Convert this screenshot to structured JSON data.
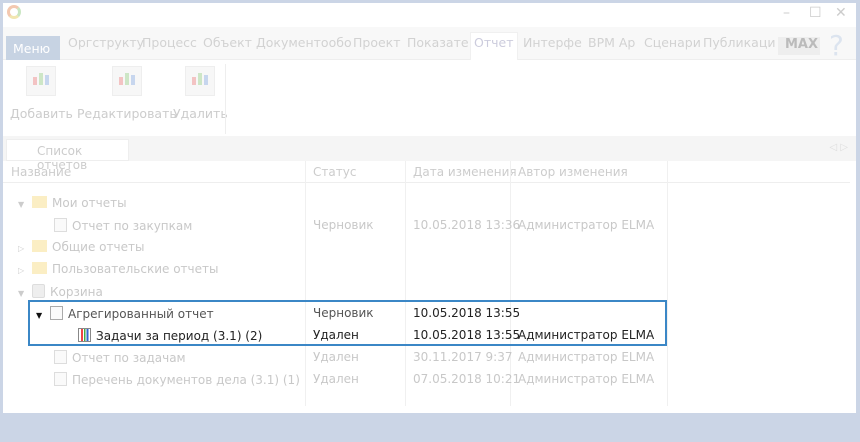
{
  "window": {
    "controls": [
      "–",
      "☐",
      "✕"
    ]
  },
  "menu": {
    "label": "Меню",
    "tabs": [
      "Оргструкту",
      "Процесс",
      "Объект",
      "Документообо",
      "Проект",
      "Показате",
      "Отчет",
      "Интерфе",
      "BPM Ap",
      "Сценари",
      "Публикаци"
    ],
    "max": "MAX",
    "help": "?"
  },
  "ribbon": {
    "add": "Добавить",
    "edit": "Редактировать",
    "delete": "Удалить"
  },
  "doc_tab": {
    "label": "Список отчетов"
  },
  "table": {
    "headers": [
      "Название",
      "Статус",
      "Дата изменения",
      "Автор изменения"
    ],
    "rows": [
      {
        "name": "Мои отчеты",
        "status": "",
        "date": "",
        "author": ""
      },
      {
        "name": "Отчет по закупкам",
        "status": "Черновик",
        "date": "10.05.2018 13:36",
        "author": "Администратор ELMA"
      },
      {
        "name": "Общие отчеты",
        "status": "",
        "date": "",
        "author": ""
      },
      {
        "name": "Пользовательские отчеты",
        "status": "",
        "date": "",
        "author": ""
      },
      {
        "name": "Корзина",
        "status": "",
        "date": "",
        "author": ""
      },
      {
        "name": "Агрегированный отчет",
        "status": "Черновик",
        "date": "10.05.2018 13:55",
        "author": ""
      },
      {
        "name": "Задачи за период (3.1) (2)",
        "status": "Удален",
        "date": "10.05.2018 13:55",
        "author": "Администратор ELMA"
      },
      {
        "name": "Отчет по задачам",
        "status": "Удален",
        "date": "30.11.2017 9:37",
        "author": "Администратор ELMA"
      },
      {
        "name": "Перечень документов дела (3.1) (1)",
        "status": "Удален",
        "date": "07.05.2018 10:21",
        "author": "Администратор ELMA"
      }
    ]
  },
  "colors": {
    "highlight": "#3b87c6",
    "menu": "#c7d3e3"
  }
}
